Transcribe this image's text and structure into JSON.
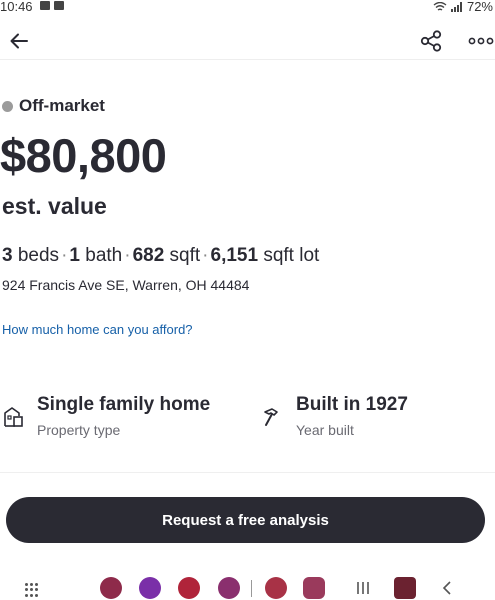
{
  "status_bar": {
    "time": "10:46",
    "battery": "72%"
  },
  "listing": {
    "status": "Off-market",
    "price": "$80,800",
    "price_label": "est. value",
    "beds_count": "3",
    "beds_label": "beds",
    "baths_count": "1",
    "baths_label": "bath",
    "sqft_count": "682",
    "sqft_label": "sqft",
    "lot_count": "6,151",
    "lot_label": "sqft lot",
    "address": "924 Francis Ave SE, Warren, OH 44484"
  },
  "afford_link": "How much home can you afford?",
  "features": [
    {
      "title": "Single family home",
      "subtitle": "Property type",
      "icon": "house-icon"
    },
    {
      "title": "Built in 1927",
      "subtitle": "Year built",
      "icon": "hammer-icon"
    }
  ],
  "cta": {
    "label": "Request a free analysis"
  },
  "colors": {
    "text": "#2a2a33",
    "link": "#1660a8",
    "status_dot": "#9b9b9b",
    "button": "#2a2a33"
  },
  "nav_apps": [
    "phone-app",
    "messages-app",
    "dialer-app",
    "chat-app",
    "maps-app",
    "gallery-app",
    "camera-app"
  ]
}
